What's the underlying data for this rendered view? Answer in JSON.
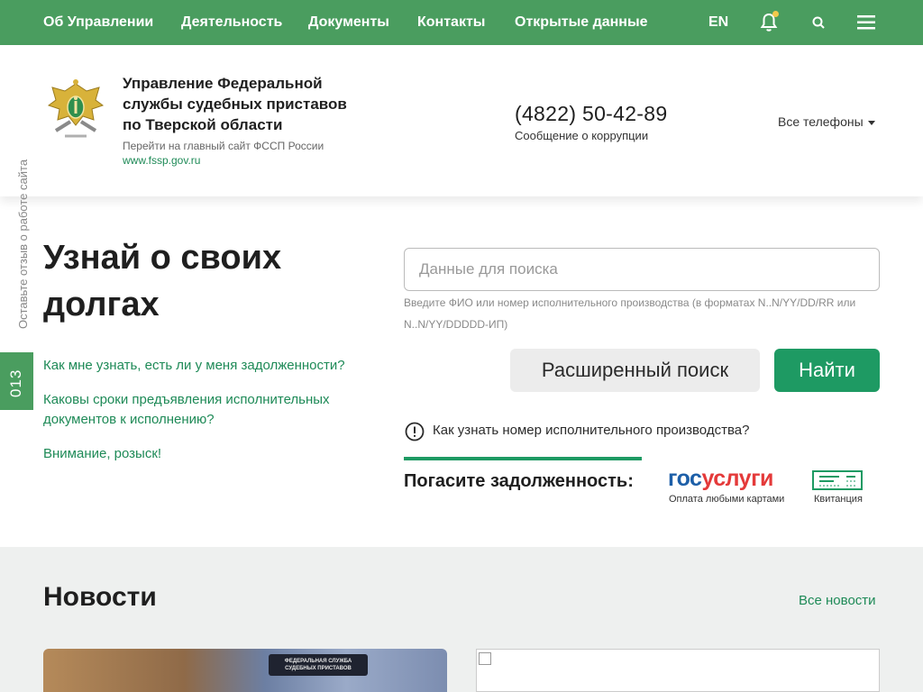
{
  "nav": {
    "items": [
      {
        "label": "Об Управлении"
      },
      {
        "label": "Деятельность"
      },
      {
        "label": "Документы"
      },
      {
        "label": "Контакты"
      },
      {
        "label": "Открытые данные"
      }
    ],
    "lang": "EN",
    "icons": [
      "bell-icon",
      "search-icon",
      "menu-icon"
    ]
  },
  "header": {
    "org_name": "Управление Федеральной службы судебных приставов по Тверской области",
    "org_sub": "Перейти на главный сайт ФССП России",
    "org_link": "www.fssp.gov.ru",
    "phone": "(4822) 50-42-89",
    "phone_sub": "Сообщение о коррупции",
    "all_phones": "Все телефоны"
  },
  "side": {
    "feedback": "Оставьте отзыв о работе сайта",
    "badge": "013"
  },
  "debt": {
    "title": "Узнай о своих долгах",
    "questions": [
      "Как мне узнать, есть ли у меня задолженности?",
      "Каковы сроки предъявления исполнительных документов к исполнению?",
      "Внимание, розыск!"
    ],
    "search_placeholder": "Данные для поиска",
    "search_hint": "Введите ФИО или номер исполнительного производства (в форматах N..N/YY/DD/RR или N..N/YY/DDDDD-ИП)",
    "advanced_button": "Расширенный поиск",
    "find_button": "Найти",
    "info_link": "Как узнать номер исполнительного производства?",
    "pay_label": "Погасите задолженность:",
    "gosuslugi_gos": "гос",
    "gosuslugi_usl": "услуги",
    "gosuslugi_caption": "Оплата любыми картами",
    "kvit_caption": "Квитанция"
  },
  "news": {
    "title": "Новости",
    "all_link": "Все новости",
    "patch_text": "ФЕДЕРАЛЬНАЯ СЛУЖБА СУДЕБНЫХ ПРИСТАВОВ"
  },
  "colors": {
    "brand_green": "#4a9d5f",
    "button_green": "#1e9a63",
    "link_green": "#1e8a57"
  }
}
